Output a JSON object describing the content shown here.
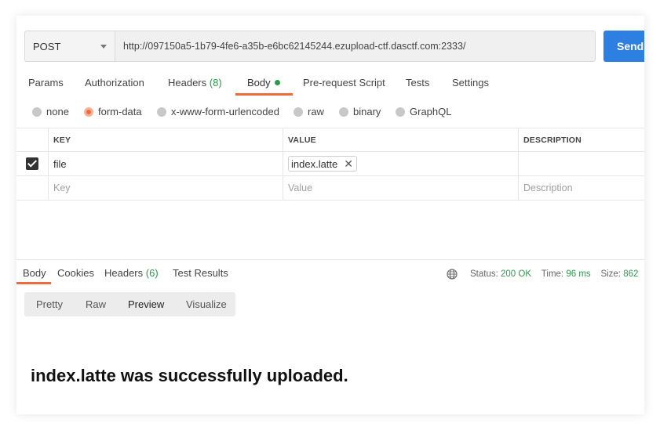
{
  "request": {
    "method": "POST",
    "url": "http://097150a5-1b79-4fe6-a35b-e6bc62145244.ezupload-ctf.dasctf.com:2333/",
    "send_label": "Send"
  },
  "request_tabs": [
    {
      "label": "Params"
    },
    {
      "label": "Authorization"
    },
    {
      "label": "Headers",
      "count": "(8)"
    },
    {
      "label": "Body",
      "active": true
    },
    {
      "label": "Pre-request Script"
    },
    {
      "label": "Tests"
    },
    {
      "label": "Settings"
    }
  ],
  "body_types": [
    {
      "label": "none",
      "checked": false
    },
    {
      "label": "form-data",
      "checked": true
    },
    {
      "label": "x-www-form-urlencoded",
      "checked": false
    },
    {
      "label": "raw",
      "checked": false
    },
    {
      "label": "binary",
      "checked": false
    },
    {
      "label": "GraphQL",
      "checked": false
    }
  ],
  "table": {
    "headers": {
      "key": "KEY",
      "value": "VALUE",
      "description": "DESCRIPTION"
    },
    "rows": [
      {
        "checked": true,
        "key": "file",
        "value": "index.latte",
        "description": ""
      }
    ],
    "placeholders": {
      "key": "Key",
      "value": "Value",
      "description": "Description"
    }
  },
  "response_tabs": [
    {
      "label": "Body",
      "active": true
    },
    {
      "label": "Cookies"
    },
    {
      "label": "Headers",
      "count": "(6)"
    },
    {
      "label": "Test Results"
    }
  ],
  "response_status": {
    "status_label": "Status:",
    "status_value": "200 OK",
    "time_label": "Time:",
    "time_value": "96 ms",
    "size_label": "Size:",
    "size_value": "862"
  },
  "view_modes": [
    {
      "label": "Pretty"
    },
    {
      "label": "Raw"
    },
    {
      "label": "Preview",
      "active": true
    },
    {
      "label": "Visualize"
    }
  ],
  "response_body": "index.latte was successfully uploaded.",
  "colors": {
    "accent": "#ef6c3a",
    "send_button": "#2d7fe2",
    "success": "#2a9b4b"
  }
}
